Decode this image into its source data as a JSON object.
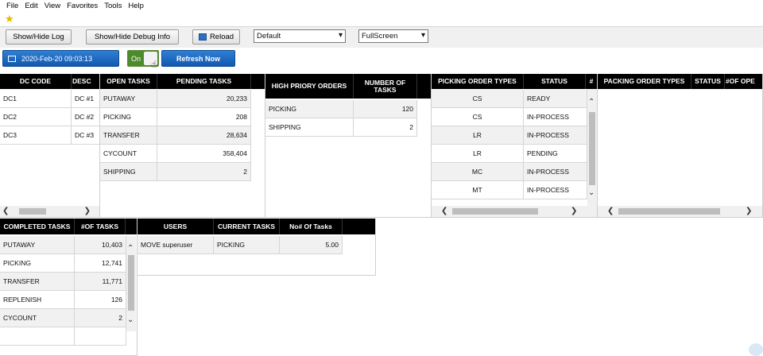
{
  "menu": [
    "File",
    "Edit",
    "View",
    "Favorites",
    "Tools",
    "Help"
  ],
  "toolbar": {
    "show_hide_log": "Show/Hide Log",
    "show_hide_debug": "Show/Hide Debug Info",
    "reload": "Reload",
    "layout_select": "Default",
    "mode_select": "FullScreen"
  },
  "controls": {
    "date": "2020-Feb-20 09:03:13",
    "toggle": "On",
    "refresh": "Refresh Now"
  },
  "dc_table": {
    "headers": [
      "DC CODE",
      "DESC"
    ],
    "rows": [
      [
        "DC1",
        "DC #1"
      ],
      [
        "DC2",
        "DC #2"
      ],
      [
        "DC3",
        "DC #3"
      ]
    ]
  },
  "open_tasks": {
    "headers": [
      "OPEN TASKS",
      "PENDING TASKS"
    ],
    "rows": [
      [
        "PUTAWAY",
        "20,233"
      ],
      [
        "PICKING",
        "208"
      ],
      [
        "TRANSFER",
        "28,634"
      ],
      [
        "CYCOUNT",
        "358,404"
      ],
      [
        "SHIPPING",
        "2"
      ]
    ]
  },
  "high_priority": {
    "headers": [
      "HIGH PRIORY ORDERS",
      "NUMBER OF TASKS"
    ],
    "rows": [
      [
        "PICKING",
        "120"
      ],
      [
        "SHIPPING",
        "2"
      ]
    ]
  },
  "picking_types": {
    "headers": [
      "PICKING ORDER TYPES",
      "STATUS",
      "#"
    ],
    "rows": [
      [
        "CS",
        "READY"
      ],
      [
        "CS",
        "IN-PROCESS"
      ],
      [
        "LR",
        "IN-PROCESS"
      ],
      [
        "LR",
        "PENDING"
      ],
      [
        "MC",
        "IN-PROCESS"
      ],
      [
        "MT",
        "IN-PROCESS"
      ]
    ]
  },
  "packing_types": {
    "headers": [
      "PACKING ORDER TYPES",
      "STATUS",
      "#OF OPE"
    ]
  },
  "completed_tasks": {
    "headers": [
      "COMPLETED TASKS",
      "#OF TASKS"
    ],
    "rows": [
      [
        "PUTAWAY",
        "10,403"
      ],
      [
        "PICKING",
        "12,741"
      ],
      [
        "TRANSFER",
        "11,771"
      ],
      [
        "REPLENISH",
        "126"
      ],
      [
        "CYCOUNT",
        "2"
      ]
    ]
  },
  "users": {
    "headers": [
      "USERS",
      "CURRENT TASKS",
      "No# Of Tasks"
    ],
    "rows": [
      [
        "MOVE superuser",
        "PICKING",
        "5.00"
      ]
    ]
  }
}
